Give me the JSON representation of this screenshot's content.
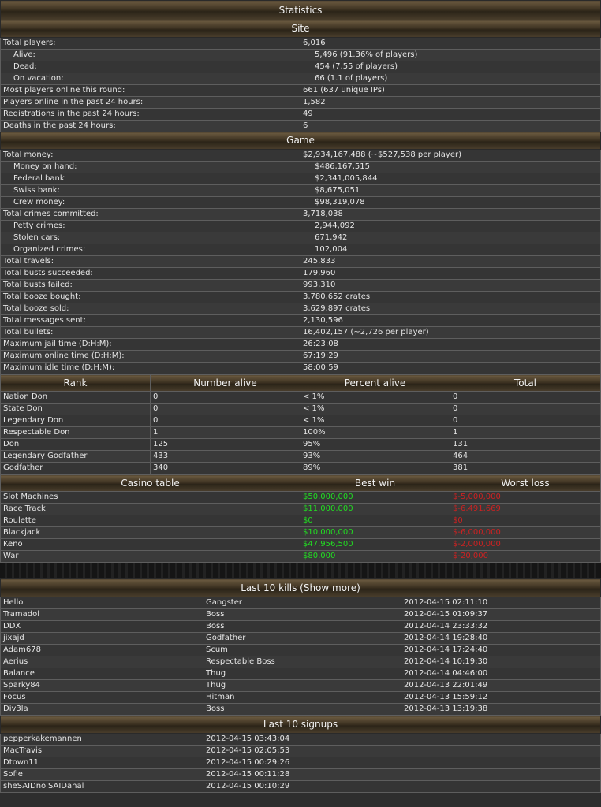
{
  "title": "Statistics",
  "site": {
    "title": "Site",
    "rows": [
      {
        "label": "Total players:",
        "value": "6,016",
        "sub": false
      },
      {
        "label": "Alive:",
        "value": "5,496 (91.36% of players)",
        "sub": true
      },
      {
        "label": "Dead:",
        "value": "454 (7.55 of players)",
        "sub": true
      },
      {
        "label": "On vacation:",
        "value": "66 (1.1 of players)",
        "sub": true
      },
      {
        "label": "Most players online this round:",
        "value": "661 (637 unique IPs)",
        "sub": false
      },
      {
        "label": "Players online in the past 24 hours:",
        "value": "1,582",
        "sub": false
      },
      {
        "label": "Registrations in the past 24 hours:",
        "value": "49",
        "sub": false
      },
      {
        "label": "Deaths in the past 24 hours:",
        "value": "6",
        "sub": false
      }
    ]
  },
  "game": {
    "title": "Game",
    "rows": [
      {
        "label": "Total money:",
        "value": "$2,934,167,488 (~$527,538 per player)",
        "sub": false
      },
      {
        "label": "Money on hand:",
        "value": "$486,167,515",
        "sub": true
      },
      {
        "label": "Federal bank",
        "value": "$2,341,005,844",
        "sub": true
      },
      {
        "label": "Swiss bank:",
        "value": "$8,675,051",
        "sub": true
      },
      {
        "label": "Crew money:",
        "value": "$98,319,078",
        "sub": true
      },
      {
        "label": "Total crimes committed:",
        "value": "3,718,038",
        "sub": false
      },
      {
        "label": "Petty crimes:",
        "value": "2,944,092",
        "sub": true
      },
      {
        "label": "Stolen cars:",
        "value": "671,942",
        "sub": true
      },
      {
        "label": "Organized crimes:",
        "value": "102,004",
        "sub": true
      },
      {
        "label": "Total travels:",
        "value": "245,833",
        "sub": false
      },
      {
        "label": "Total busts succeeded:",
        "value": "179,960",
        "sub": false
      },
      {
        "label": "Total busts failed:",
        "value": "993,310",
        "sub": false
      },
      {
        "label": "Total booze bought:",
        "value": "3,780,652 crates",
        "sub": false
      },
      {
        "label": "Total booze sold:",
        "value": "3,629,897 crates",
        "sub": false
      },
      {
        "label": "Total messages sent:",
        "value": "2,130,596",
        "sub": false
      },
      {
        "label": "Total bullets:",
        "value": "16,402,157 (~2,726 per player)",
        "sub": false
      },
      {
        "label": "Maximum jail time (D:H:M):",
        "value": "26:23:08",
        "sub": false
      },
      {
        "label": "Maximum online time (D:H:M):",
        "value": "67:19:29",
        "sub": false
      },
      {
        "label": "Maximum idle time (D:H:M):",
        "value": "58:00:59",
        "sub": false
      }
    ]
  },
  "ranks": {
    "headers": [
      "Rank",
      "Number alive",
      "Percent alive",
      "Total"
    ],
    "rows": [
      [
        "Nation Don",
        "0",
        "< 1%",
        "0"
      ],
      [
        "State Don",
        "0",
        "< 1%",
        "0"
      ],
      [
        "Legendary Don",
        "0",
        "< 1%",
        "0"
      ],
      [
        "Respectable Don",
        "1",
        "100%",
        "1"
      ],
      [
        "Don",
        "125",
        "95%",
        "131"
      ],
      [
        "Legendary Godfather",
        "433",
        "93%",
        "464"
      ],
      [
        "Godfather",
        "340",
        "89%",
        "381"
      ]
    ]
  },
  "casino": {
    "headers": [
      "Casino table",
      "Best win",
      "Worst loss"
    ],
    "rows": [
      [
        "Slot Machines",
        "$50,000,000",
        "$-5,000,000"
      ],
      [
        "Race Track",
        "$11,000,000",
        "$-6,491,669"
      ],
      [
        "Roulette",
        "$0",
        "$0"
      ],
      [
        "Blackjack",
        "$10,000,000",
        "$-6,000,000"
      ],
      [
        "Keno",
        "$47,956,500",
        "$-2,000,000"
      ],
      [
        "War",
        "$80,000",
        "$-20,000"
      ]
    ],
    "colors": {
      "win": "#22dd22",
      "loss": "#cc2222"
    }
  },
  "kills": {
    "title": "Last 10 kills (Show more)",
    "rows": [
      [
        "Hello",
        "Gangster",
        "2012-04-15 02:11:10"
      ],
      [
        "Tramadol",
        "Boss",
        "2012-04-15 01:09:37"
      ],
      [
        "DDX",
        "Boss",
        "2012-04-14 23:33:32"
      ],
      [
        "jixajd",
        "Godfather",
        "2012-04-14 19:28:40"
      ],
      [
        "Adam678",
        "Scum",
        "2012-04-14 17:24:40"
      ],
      [
        "Aerius",
        "Respectable Boss",
        "2012-04-14 10:19:30"
      ],
      [
        "Balance",
        "Thug",
        "2012-04-14 04:46:00"
      ],
      [
        "Sparky84",
        "Thug",
        "2012-04-13 22:01:49"
      ],
      [
        "Focus",
        "Hitman",
        "2012-04-13 15:59:12"
      ],
      [
        "Div3la",
        "Boss",
        "2012-04-13 13:19:38"
      ]
    ]
  },
  "signups": {
    "title": "Last 10 signups",
    "rows": [
      [
        "pepperkakemannen",
        "2012-04-15 03:43:04"
      ],
      [
        "MacTravis",
        "2012-04-15 02:05:53"
      ],
      [
        "Dtown11",
        "2012-04-15 00:29:26"
      ],
      [
        "Sofie",
        "2012-04-15 00:11:28"
      ],
      [
        "sheSAIDnoiSAIDanal",
        "2012-04-15 00:10:29"
      ]
    ]
  }
}
